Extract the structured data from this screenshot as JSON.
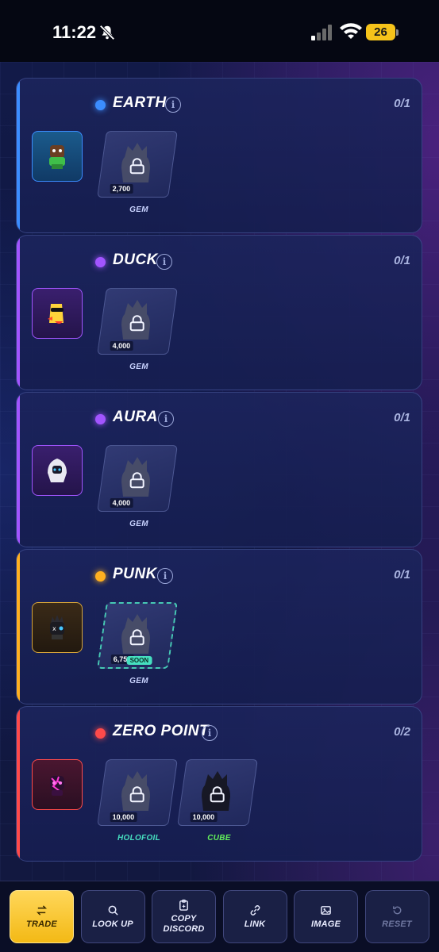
{
  "status_bar": {
    "time": "11:22",
    "battery": "26"
  },
  "colors": {
    "common": "#3b8dff",
    "rare": "#a255ff",
    "epic": "#ffb020",
    "legendary": "#ff4a4a",
    "holofoil": "#46e0c0",
    "cube": "#62f05a",
    "gem": "#c9d3ff"
  },
  "cards": [
    {
      "title": "EARTH",
      "count": "0/1",
      "rarity_color": "#3b8dff",
      "slots": [
        {
          "price": "2,700",
          "label": "GEM",
          "badge": ""
        }
      ]
    },
    {
      "title": "DUCK",
      "count": "0/1",
      "rarity_color": "#a255ff",
      "slots": [
        {
          "price": "4,000",
          "label": "GEM",
          "badge": ""
        }
      ]
    },
    {
      "title": "AURA",
      "count": "0/1",
      "rarity_color": "#a255ff",
      "slots": [
        {
          "price": "4,000",
          "label": "GEM",
          "badge": ""
        }
      ]
    },
    {
      "title": "PUNK",
      "count": "0/1",
      "rarity_color": "#ffb020",
      "slots": [
        {
          "price": "6,750",
          "label": "GEM",
          "badge": "SOON"
        }
      ]
    },
    {
      "title": "ZERO POINT",
      "count": "0/2",
      "rarity_color": "#ff4a4a",
      "slots": [
        {
          "price": "10,000",
          "label": "HOLOFOIL",
          "badge": ""
        },
        {
          "price": "10,000",
          "label": "CUBE",
          "badge": ""
        }
      ]
    }
  ],
  "actions": [
    {
      "label": "TRADE",
      "icon": "swap-icon"
    },
    {
      "label": "LOOK UP",
      "icon": "search-icon"
    },
    {
      "label": "COPY\nDISCORD",
      "icon": "clipboard-icon"
    },
    {
      "label": "LINK",
      "icon": "link-icon"
    },
    {
      "label": "IMAGE",
      "icon": "image-icon"
    },
    {
      "label": "RESET",
      "icon": "reset-icon"
    }
  ]
}
